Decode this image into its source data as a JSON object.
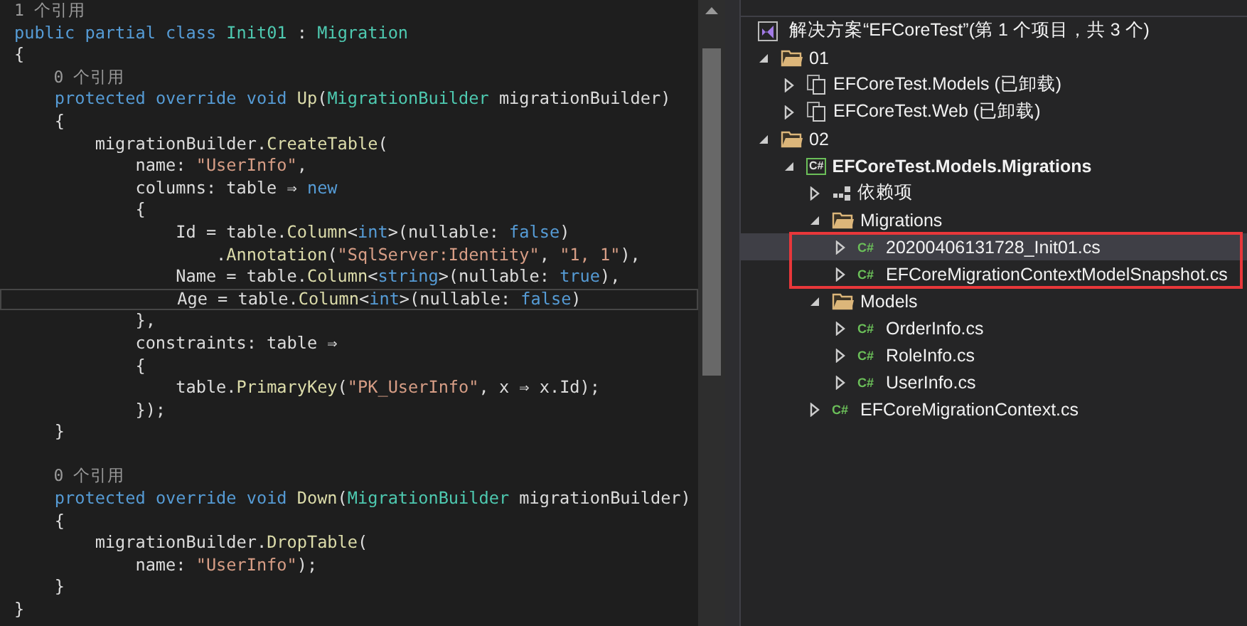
{
  "editor": {
    "lines": [
      {
        "kind": "codelens",
        "tokens": [
          {
            "kind": "lens",
            "text": "1 个引用"
          }
        ]
      },
      {
        "kind": "code",
        "tokens": [
          {
            "kind": "kw",
            "text": "public "
          },
          {
            "kind": "kw",
            "text": "partial "
          },
          {
            "kind": "kw",
            "text": "class "
          },
          {
            "kind": "type",
            "text": "Init01"
          },
          {
            "kind": "plain",
            "text": " : "
          },
          {
            "kind": "type",
            "text": "Migration"
          }
        ]
      },
      {
        "kind": "code",
        "tokens": [
          {
            "kind": "plain",
            "text": "{"
          }
        ]
      },
      {
        "kind": "codelens",
        "tokens": [
          {
            "kind": "lens",
            "text": "    0 个引用"
          }
        ]
      },
      {
        "kind": "code",
        "tokens": [
          {
            "kind": "kw",
            "text": "    protected "
          },
          {
            "kind": "kw",
            "text": "override "
          },
          {
            "kind": "kw",
            "text": "void "
          },
          {
            "kind": "method",
            "text": "Up"
          },
          {
            "kind": "plain",
            "text": "("
          },
          {
            "kind": "type",
            "text": "MigrationBuilder"
          },
          {
            "kind": "plain",
            "text": " migrationBuilder)"
          }
        ]
      },
      {
        "kind": "code",
        "tokens": [
          {
            "kind": "plain",
            "text": "    {"
          }
        ]
      },
      {
        "kind": "code",
        "tokens": [
          {
            "kind": "plain",
            "text": "        migrationBuilder."
          },
          {
            "kind": "method",
            "text": "CreateTable"
          },
          {
            "kind": "plain",
            "text": "("
          }
        ]
      },
      {
        "kind": "code",
        "tokens": [
          {
            "kind": "plain",
            "text": "            name: "
          },
          {
            "kind": "str",
            "text": "\"UserInfo\""
          },
          {
            "kind": "plain",
            "text": ","
          }
        ]
      },
      {
        "kind": "code",
        "tokens": [
          {
            "kind": "plain",
            "text": "            columns: table ⇒ "
          },
          {
            "kind": "kw",
            "text": "new"
          }
        ]
      },
      {
        "kind": "code",
        "tokens": [
          {
            "kind": "plain",
            "text": "            {"
          }
        ]
      },
      {
        "kind": "code",
        "tokens": [
          {
            "kind": "plain",
            "text": "                Id = table."
          },
          {
            "kind": "method",
            "text": "Column"
          },
          {
            "kind": "plain",
            "text": "<"
          },
          {
            "kind": "kw",
            "text": "int"
          },
          {
            "kind": "plain",
            "text": ">(nullable: "
          },
          {
            "kind": "kw",
            "text": "false"
          },
          {
            "kind": "plain",
            "text": ")"
          }
        ]
      },
      {
        "kind": "code",
        "tokens": [
          {
            "kind": "plain",
            "text": "                    ."
          },
          {
            "kind": "method",
            "text": "Annotation"
          },
          {
            "kind": "plain",
            "text": "("
          },
          {
            "kind": "str",
            "text": "\"SqlServer:Identity\""
          },
          {
            "kind": "plain",
            "text": ", "
          },
          {
            "kind": "str",
            "text": "\"1, 1\""
          },
          {
            "kind": "plain",
            "text": "),"
          }
        ]
      },
      {
        "kind": "code",
        "tokens": [
          {
            "kind": "plain",
            "text": "                Name = table."
          },
          {
            "kind": "method",
            "text": "Column"
          },
          {
            "kind": "plain",
            "text": "<"
          },
          {
            "kind": "kw",
            "text": "string"
          },
          {
            "kind": "plain",
            "text": ">(nullable: "
          },
          {
            "kind": "kw",
            "text": "true"
          },
          {
            "kind": "plain",
            "text": "),"
          }
        ]
      },
      {
        "kind": "code",
        "current": true,
        "tokens": [
          {
            "kind": "plain",
            "text": "                Age = table."
          },
          {
            "kind": "method",
            "text": "Column"
          },
          {
            "kind": "plain",
            "text": "<"
          },
          {
            "kind": "kw",
            "text": "int"
          },
          {
            "kind": "plain",
            "text": ">(nullable: "
          },
          {
            "kind": "kw",
            "text": "false"
          },
          {
            "kind": "plain",
            "text": ")"
          }
        ]
      },
      {
        "kind": "code",
        "tokens": [
          {
            "kind": "plain",
            "text": "            },"
          }
        ]
      },
      {
        "kind": "code",
        "tokens": [
          {
            "kind": "plain",
            "text": "            constraints: table ⇒"
          }
        ]
      },
      {
        "kind": "code",
        "tokens": [
          {
            "kind": "plain",
            "text": "            {"
          }
        ]
      },
      {
        "kind": "code",
        "tokens": [
          {
            "kind": "plain",
            "text": "                table."
          },
          {
            "kind": "method",
            "text": "PrimaryKey"
          },
          {
            "kind": "plain",
            "text": "("
          },
          {
            "kind": "str",
            "text": "\"PK_UserInfo\""
          },
          {
            "kind": "plain",
            "text": ", x ⇒ x.Id);"
          }
        ]
      },
      {
        "kind": "code",
        "tokens": [
          {
            "kind": "plain",
            "text": "            });"
          }
        ]
      },
      {
        "kind": "code",
        "tokens": [
          {
            "kind": "plain",
            "text": "    }"
          }
        ]
      },
      {
        "kind": "blank"
      },
      {
        "kind": "codelens",
        "tokens": [
          {
            "kind": "lens",
            "text": "    0 个引用"
          }
        ]
      },
      {
        "kind": "code",
        "tokens": [
          {
            "kind": "kw",
            "text": "    protected "
          },
          {
            "kind": "kw",
            "text": "override "
          },
          {
            "kind": "kw",
            "text": "void "
          },
          {
            "kind": "method",
            "text": "Down"
          },
          {
            "kind": "plain",
            "text": "("
          },
          {
            "kind": "type",
            "text": "MigrationBuilder"
          },
          {
            "kind": "plain",
            "text": " migrationBuilder)"
          }
        ]
      },
      {
        "kind": "code",
        "tokens": [
          {
            "kind": "plain",
            "text": "    {"
          }
        ]
      },
      {
        "kind": "code",
        "tokens": [
          {
            "kind": "plain",
            "text": "        migrationBuilder."
          },
          {
            "kind": "method",
            "text": "DropTable"
          },
          {
            "kind": "plain",
            "text": "("
          }
        ]
      },
      {
        "kind": "code",
        "tokens": [
          {
            "kind": "plain",
            "text": "            name: "
          },
          {
            "kind": "str",
            "text": "\"UserInfo\""
          },
          {
            "kind": "plain",
            "text": ");"
          }
        ]
      },
      {
        "kind": "code",
        "tokens": [
          {
            "kind": "plain",
            "text": "    }"
          }
        ]
      },
      {
        "kind": "code",
        "tokens": [
          {
            "kind": "plain",
            "text": "}"
          }
        ]
      }
    ]
  },
  "solution_explorer": {
    "solution": {
      "label": "解决方案“EFCoreTest”(第 1 个项目，共 3 个)"
    },
    "tree": [
      {
        "label": "01",
        "kind": "folder",
        "expanded": true,
        "selected": false,
        "children": [
          {
            "label": "EFCoreTest.Models (已卸载)",
            "kind": "unloaded",
            "expanded": false,
            "selected": false
          },
          {
            "label": "EFCoreTest.Web (已卸载)",
            "kind": "unloaded",
            "expanded": false,
            "selected": false
          }
        ]
      },
      {
        "label": "02",
        "kind": "folder",
        "expanded": true,
        "selected": false,
        "children": [
          {
            "label": "EFCoreTest.Models.Migrations",
            "kind": "csproj",
            "icon_text": "C#",
            "bold": true,
            "expanded": true,
            "selected": false,
            "children": [
              {
                "label": "依赖项",
                "kind": "dependencies",
                "expanded": false,
                "selected": false
              },
              {
                "label": "Migrations",
                "kind": "folder",
                "expanded": true,
                "selected": false,
                "children": [
                  {
                    "label": "20200406131728_Init01.cs",
                    "kind": "csharp",
                    "icon_text": "C#",
                    "expanded": false,
                    "selected": true,
                    "highlighted": true
                  },
                  {
                    "label": "EFCoreMigrationContextModelSnapshot.cs",
                    "kind": "csharp",
                    "icon_text": "C#",
                    "expanded": false,
                    "selected": false,
                    "highlighted": true
                  }
                ]
              },
              {
                "label": "Models",
                "kind": "folder",
                "expanded": true,
                "selected": false,
                "children": [
                  {
                    "label": "OrderInfo.cs",
                    "kind": "csharp",
                    "icon_text": "C#",
                    "expanded": false,
                    "selected": false
                  },
                  {
                    "label": "RoleInfo.cs",
                    "kind": "csharp",
                    "icon_text": "C#",
                    "expanded": false,
                    "selected": false
                  },
                  {
                    "label": "UserInfo.cs",
                    "kind": "csharp",
                    "icon_text": "C#",
                    "expanded": false,
                    "selected": false
                  }
                ]
              },
              {
                "label": "EFCoreMigrationContext.cs",
                "kind": "csharp",
                "icon_text": "C#",
                "expanded": false,
                "selected": false
              }
            ]
          }
        ]
      }
    ]
  }
}
